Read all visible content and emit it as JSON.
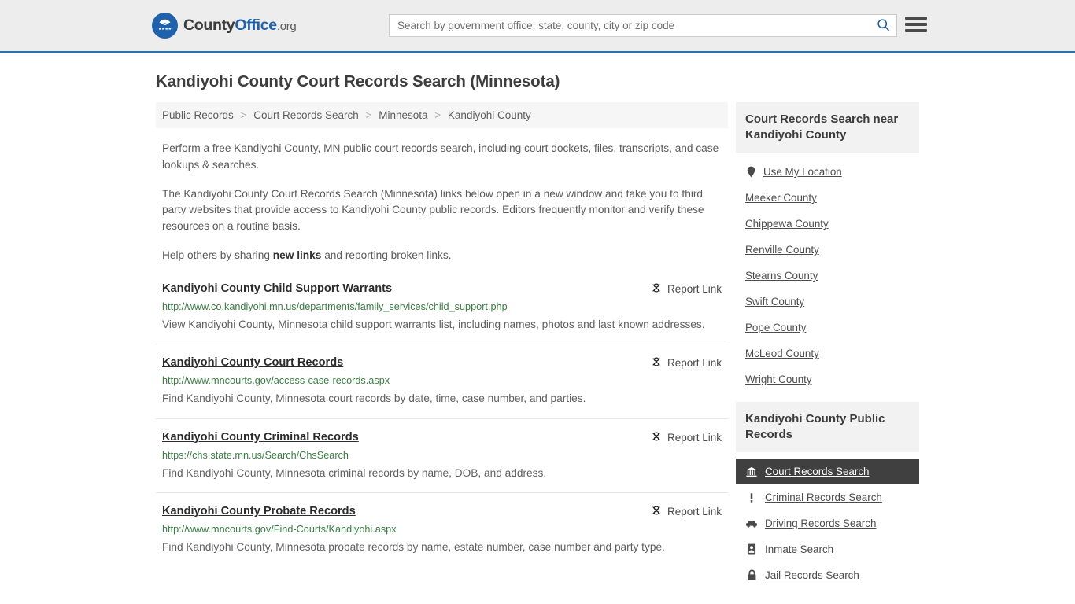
{
  "header": {
    "logo": {
      "part1": "County",
      "part2": "Office",
      "tld": ".org",
      "icon": "eagle-seal-icon"
    },
    "search": {
      "placeholder": "Search by government office, state, county, city or zip code",
      "value": "",
      "button_icon": "search-icon"
    },
    "menu_icon": "hamburger-menu-icon",
    "accent_color": "#2f6fa8",
    "background_color": "#ededed"
  },
  "page_title": "Kandiyohi County Court Records Search (Minnesota)",
  "breadcrumb": {
    "separator": ">",
    "items": [
      {
        "label": "Public Records"
      },
      {
        "label": "Court Records Search"
      },
      {
        "label": "Minnesota"
      },
      {
        "label": "Kandiyohi County"
      }
    ]
  },
  "intro": {
    "paragraph1": "Perform a free Kandiyohi County, MN public court records search, including court dockets, files, transcripts, and case lookups & searches.",
    "paragraph2": "The Kandiyohi County Court Records Search (Minnesota) links below open in a new window and take you to third party websites that provide access to Kandiyohi County public records. Editors frequently monitor and verify these resources on a routine basis.",
    "paragraph3_before": "Help others by sharing ",
    "paragraph3_link": "new links",
    "paragraph3_after": " and reporting broken links."
  },
  "results": {
    "report_label": "Report Link",
    "report_icon": "broken-link-icon",
    "items": [
      {
        "title": "Kandiyohi County Child Support Warrants",
        "url": "http://www.co.kandiyohi.mn.us/departments/family_services/child_support.php",
        "description": "View Kandiyohi County, Minnesota child support warrants list, including names, photos and last known addresses."
      },
      {
        "title": "Kandiyohi County Court Records",
        "url": "http://www.mncourts.gov/access-case-records.aspx",
        "description": "Find Kandiyohi County, Minnesota court records by date, time, case number, and parties."
      },
      {
        "title": "Kandiyohi County Criminal Records",
        "url": "https://chs.state.mn.us/Search/ChsSearch",
        "description": "Find Kandiyohi County, Minnesota criminal records by name, DOB, and address."
      },
      {
        "title": "Kandiyohi County Probate Records",
        "url": "http://www.mncourts.gov/Find-Courts/Kandiyohi.aspx",
        "description": "Find Kandiyohi County, Minnesota probate records by name, estate number, case number and party type."
      }
    ]
  },
  "sidebar": {
    "nearby": {
      "heading": "Court Records Search near Kandiyohi County",
      "use_my_location": {
        "label": "Use My Location",
        "icon": "map-pin-icon"
      },
      "counties": [
        {
          "label": "Meeker County"
        },
        {
          "label": "Chippewa County"
        },
        {
          "label": "Renville County"
        },
        {
          "label": "Stearns County"
        },
        {
          "label": "Swift County"
        },
        {
          "label": "Pope County"
        },
        {
          "label": "McLeod County"
        },
        {
          "label": "Wright County"
        }
      ]
    },
    "public_records": {
      "heading": "Kandiyohi County Public Records",
      "active_color": "#404040",
      "items": [
        {
          "label": "Court Records Search",
          "icon": "courthouse-icon",
          "active": true
        },
        {
          "label": "Criminal Records Search",
          "icon": "exclamation-icon",
          "active": false
        },
        {
          "label": "Driving Records Search",
          "icon": "car-icon",
          "active": false
        },
        {
          "label": "Inmate Search",
          "icon": "id-card-icon",
          "active": false
        },
        {
          "label": "Jail Records Search",
          "icon": "lock-icon",
          "active": false
        }
      ]
    }
  }
}
